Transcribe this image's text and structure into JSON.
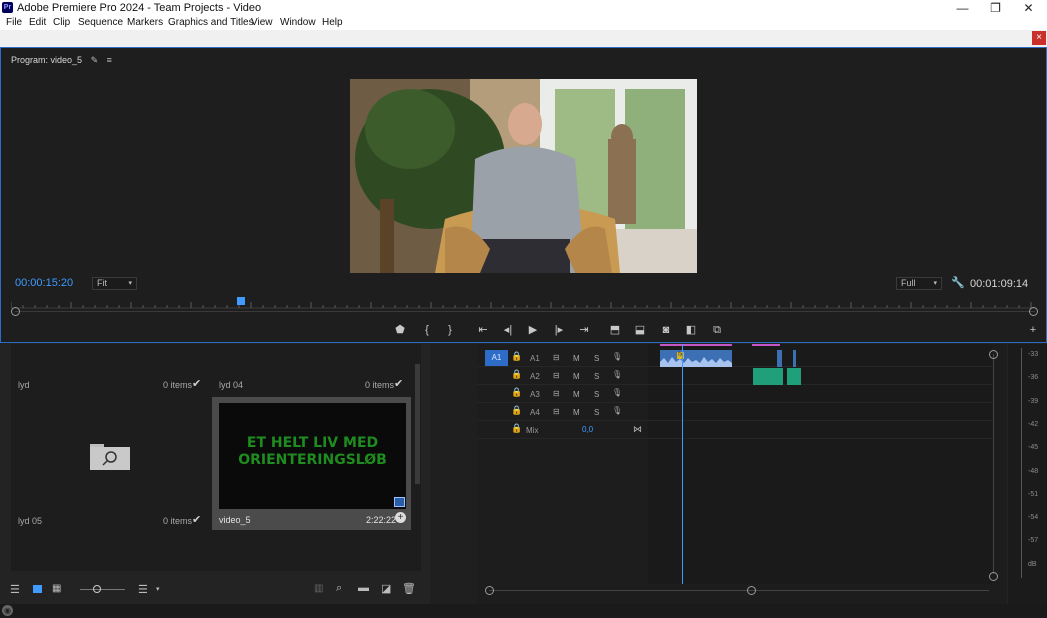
{
  "window": {
    "title": "Adobe Premiere Pro 2024 - Team Projects - Video",
    "app_icon": "Pr"
  },
  "window_controls": {
    "minimize": "—",
    "maximize": "❐",
    "close": "✕"
  },
  "menu": [
    "File",
    "Edit",
    "Clip",
    "Sequence",
    "Markers",
    "Graphics and Titles",
    "View",
    "Window",
    "Help"
  ],
  "panel_close": "×",
  "program": {
    "title": "Program: video_5",
    "timecode_current": "00:00:15:20",
    "zoom": "Fit",
    "resolution": "Full",
    "timecode_duration": "00:01:09:14",
    "playhead_fraction": 0.224
  },
  "project": {
    "bins": [
      {
        "name": "lyd",
        "count": "0 items"
      },
      {
        "name": "lyd 04",
        "count": "0 items"
      },
      {
        "name": "lyd 05",
        "count": "0 items"
      }
    ],
    "clip": {
      "name": "video_5",
      "duration": "2:22:22",
      "thumb_text": "ET HELT LIV MED ORIENTERINGSLØB"
    }
  },
  "timeline": {
    "tracks": [
      {
        "target": "A1",
        "name": "A1",
        "m": "M",
        "s": "S"
      },
      {
        "target": "",
        "name": "A2",
        "m": "M",
        "s": "S"
      },
      {
        "target": "",
        "name": "A3",
        "m": "M",
        "s": "S"
      },
      {
        "target": "",
        "name": "A4",
        "m": "M",
        "s": "S"
      }
    ],
    "mix_label": "Mix",
    "mix_value": "0,0",
    "clip_fx_badge": "fx"
  },
  "meter": {
    "db_labels": [
      "-33",
      "-36",
      "-39",
      "-42",
      "-45",
      "-48",
      "-51",
      "-54",
      "-57",
      "dB"
    ]
  },
  "colors": {
    "accent_blue": "#2d6dc8",
    "timecode_blue": "#3f9bff",
    "audio_clip": "#3d6fb4",
    "audio_green": "#1fa07a",
    "marker_pink": "#c556c5"
  }
}
